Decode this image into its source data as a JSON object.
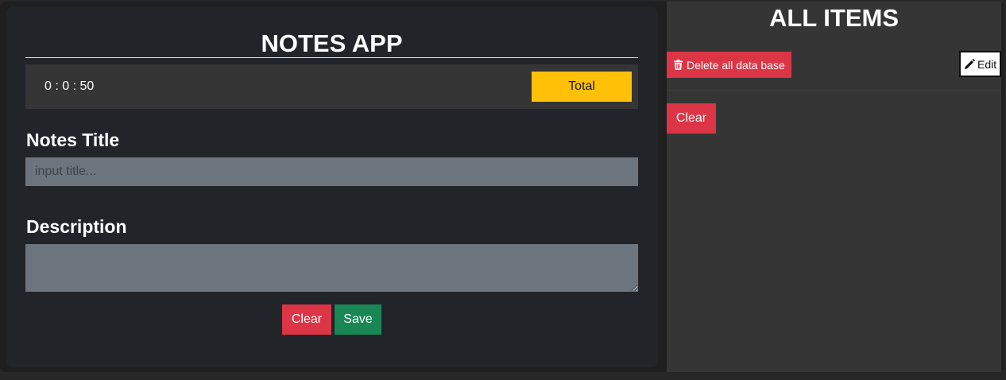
{
  "notes": {
    "title": "NOTES APP",
    "timer": "0 : 0 : 50",
    "total_label": "Total",
    "title_label": "Notes Title",
    "title_placeholder": "input title...",
    "title_value": "",
    "description_label": "Description",
    "description_value": "",
    "clear_label": "Clear",
    "save_label": "Save"
  },
  "items": {
    "title": "ALL ITEMS",
    "delete_all_label": "Delete all data base",
    "edit_label": "Edit",
    "clear_label": "Clear"
  },
  "colors": {
    "danger": "#dc3545",
    "success": "#198754",
    "warning": "#ffc107",
    "panel": "#212429",
    "sidebar": "#353535",
    "input": "#6c757d"
  },
  "icons": {
    "delete": "trash-icon",
    "edit": "pencil-icon"
  }
}
